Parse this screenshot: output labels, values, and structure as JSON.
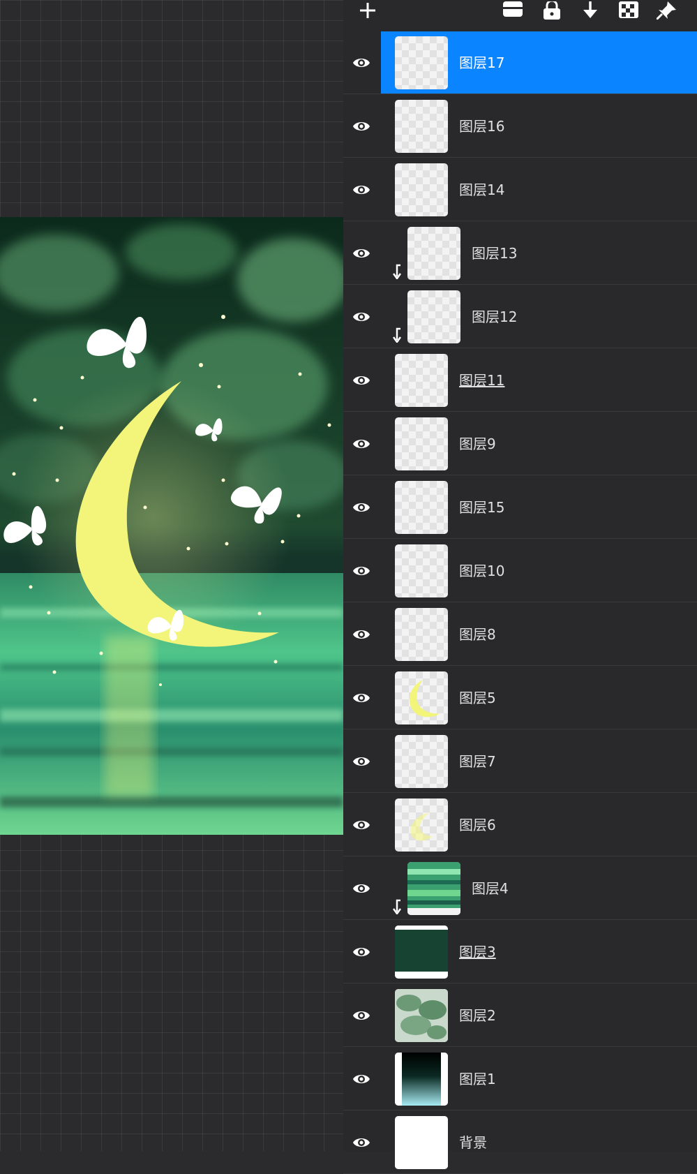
{
  "toolbar": {
    "icons": [
      "add-icon",
      "merge-icon",
      "lock-icon",
      "move-down-icon",
      "transparency-icon",
      "pin-icon"
    ]
  },
  "layers": [
    {
      "name": "图层17",
      "selected": true,
      "clipped": false,
      "underline": false,
      "thumb": "empty"
    },
    {
      "name": "图层16",
      "selected": false,
      "clipped": false,
      "underline": false,
      "thumb": "empty"
    },
    {
      "name": "图层14",
      "selected": false,
      "clipped": false,
      "underline": false,
      "thumb": "empty"
    },
    {
      "name": "图层13",
      "selected": false,
      "clipped": true,
      "underline": false,
      "thumb": "empty"
    },
    {
      "name": "图层12",
      "selected": false,
      "clipped": true,
      "underline": false,
      "thumb": "empty"
    },
    {
      "name": "图层11",
      "selected": false,
      "clipped": false,
      "underline": true,
      "thumb": "empty"
    },
    {
      "name": "图层9",
      "selected": false,
      "clipped": false,
      "underline": false,
      "thumb": "empty"
    },
    {
      "name": "图层15",
      "selected": false,
      "clipped": false,
      "underline": false,
      "thumb": "empty"
    },
    {
      "name": "图层10",
      "selected": false,
      "clipped": false,
      "underline": false,
      "thumb": "empty"
    },
    {
      "name": "图层8",
      "selected": false,
      "clipped": false,
      "underline": false,
      "thumb": "empty"
    },
    {
      "name": "图层5",
      "selected": false,
      "clipped": false,
      "underline": false,
      "thumb": "moon"
    },
    {
      "name": "图层7",
      "selected": false,
      "clipped": false,
      "underline": false,
      "thumb": "empty"
    },
    {
      "name": "图层6",
      "selected": false,
      "clipped": false,
      "underline": false,
      "thumb": "moon-faint"
    },
    {
      "name": "图层4",
      "selected": false,
      "clipped": true,
      "underline": false,
      "thumb": "water"
    },
    {
      "name": "图层3",
      "selected": false,
      "clipped": false,
      "underline": true,
      "thumb": "darkgreen"
    },
    {
      "name": "图层2",
      "selected": false,
      "clipped": false,
      "underline": false,
      "thumb": "foliage"
    },
    {
      "name": "图层1",
      "selected": false,
      "clipped": false,
      "underline": false,
      "thumb": "gradient"
    },
    {
      "name": "背景",
      "selected": false,
      "clipped": false,
      "underline": false,
      "thumb": "white"
    }
  ],
  "colors": {
    "selected": "#0a84ff",
    "panel": "#29292b",
    "moon": "#f3f57a"
  }
}
